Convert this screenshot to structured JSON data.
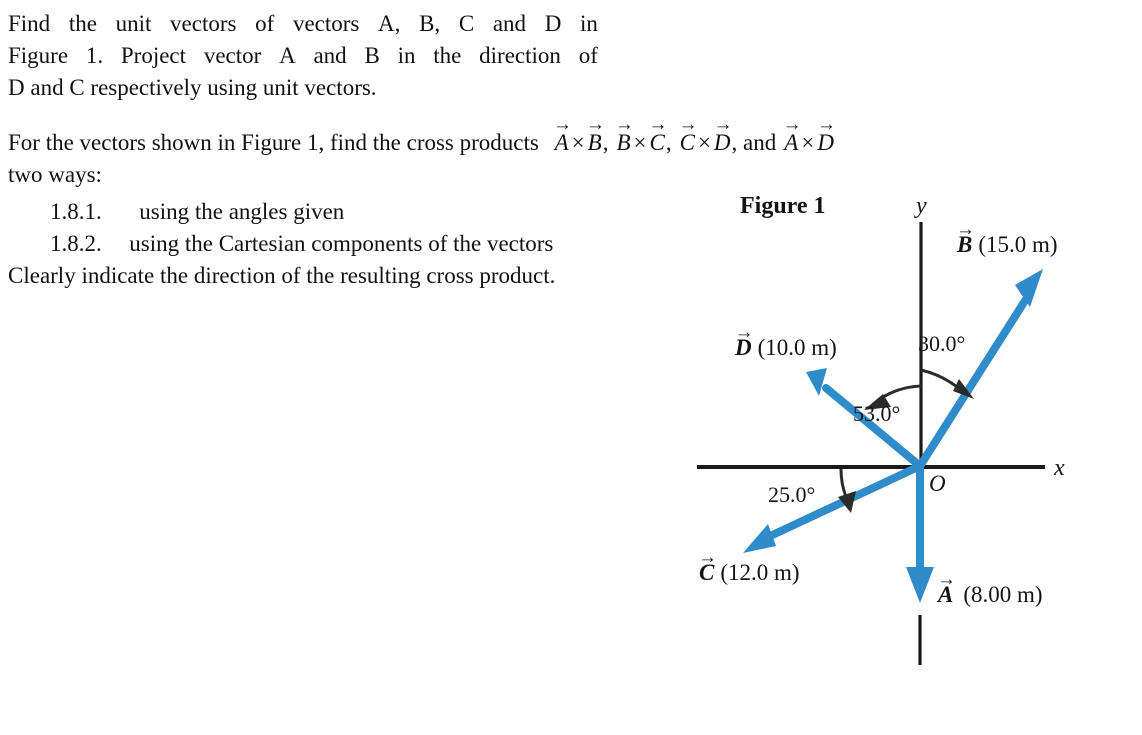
{
  "problem": {
    "intro": {
      "line1": "Find the unit vectors of vectors A, B, C and D in",
      "line2": "Figure 1. Project vector A and B in the direction of",
      "line3": "D and C respectively using unit vectors."
    },
    "cross_products": {
      "lead": "For the vectors shown in Figure 1, find the cross products",
      "items": [
        {
          "left": "A",
          "op": "×",
          "right": "B",
          "trail": ","
        },
        {
          "left": "B",
          "op": "×",
          "right": "C",
          "trail": ","
        },
        {
          "left": "C",
          "op": "×",
          "right": "D",
          "trail": ", and"
        },
        {
          "left": "A",
          "op": "×",
          "right": "D",
          "trail": ""
        }
      ],
      "line2": "two ways:"
    },
    "list": {
      "items": [
        {
          "number": "1.8.1.",
          "text": "using the angles given"
        },
        {
          "number": "1.8.2.",
          "text": "using the Cartesian components of the vectors"
        }
      ],
      "closing": "Clearly indicate the direction of the resulting cross product."
    }
  },
  "figure": {
    "title": "Figure 1",
    "axis_x_label": "x",
    "axis_y_label": "y",
    "origin_label": "O",
    "vectors": [
      {
        "name": "A",
        "symbol": "A",
        "magnitude": "(8.00 m)",
        "magnitude_value": 8.0,
        "unit": "m",
        "direction_deg_from_plus_y": 180,
        "angle_note": "along negative y axis"
      },
      {
        "name": "B",
        "symbol": "B",
        "magnitude": "(15.0 m)",
        "magnitude_value": 15.0,
        "unit": "m",
        "direction_deg_from_plus_y": 30,
        "angle_note": "30.0 degrees from +y toward +x"
      },
      {
        "name": "C",
        "symbol": "C",
        "magnitude": "(12.0 m)",
        "magnitude_value": 12.0,
        "unit": "m",
        "direction_deg_from_minus_x": 25,
        "angle_note": "25.0 degrees below the negative x axis"
      },
      {
        "name": "D",
        "symbol": "D",
        "magnitude": "(10.0 m)",
        "magnitude_value": 10.0,
        "unit": "m",
        "direction_deg_from_plus_y": 53,
        "angle_note": "53.0 degrees from +y toward -x"
      }
    ],
    "angles": [
      {
        "id": "angle-30",
        "label": "30.0°",
        "value": 30.0,
        "between": "y-axis and vector B"
      },
      {
        "id": "angle-53",
        "label": "53.0°",
        "value": 53.0,
        "between": "y-axis and vector D"
      },
      {
        "id": "angle-25",
        "label": "25.0°",
        "value": 25.0,
        "between": "negative x-axis and vector C"
      }
    ],
    "colors": {
      "vector_blue": "#2F8BC9",
      "axis_black": "#1A1A1A",
      "text_black": "#141414"
    }
  }
}
